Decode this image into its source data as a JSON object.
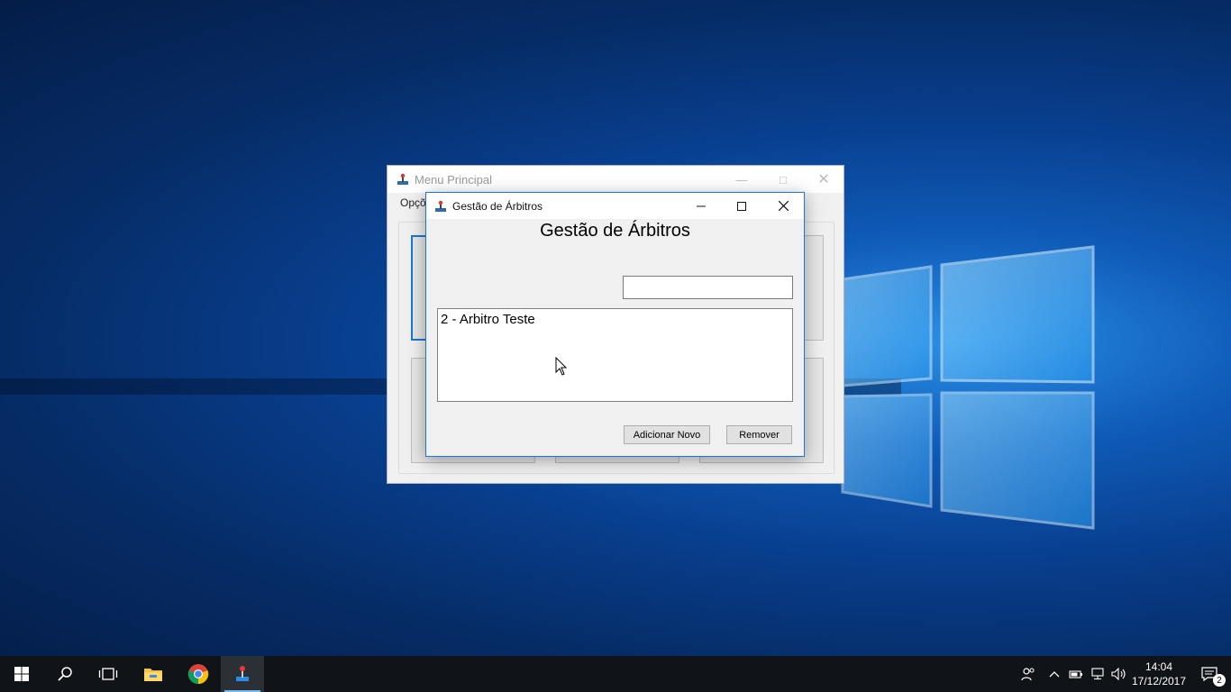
{
  "back_window": {
    "title": "Menu Principal",
    "menu": [
      "Opçõ"
    ]
  },
  "front_window": {
    "title": "Gestão de Árbitros",
    "heading": "Gestão de Árbitros",
    "search": {
      "value": "",
      "placeholder": ""
    },
    "list_items": [
      "2 - Arbitro Teste"
    ],
    "buttons": {
      "add": "Adicionar Novo",
      "remove": "Remover"
    }
  },
  "taskbar": {
    "pinned": [
      "start-icon",
      "search-icon",
      "task-view-icon",
      "file-explorer-icon",
      "chrome-icon",
      "app-icon"
    ],
    "clock": {
      "time": "14:04",
      "date": "17/12/2017"
    },
    "notification_count": "2"
  },
  "colors": {
    "accent": "#1a78d0",
    "taskbar": "#101419",
    "window_bg": "#f0f0f0"
  }
}
